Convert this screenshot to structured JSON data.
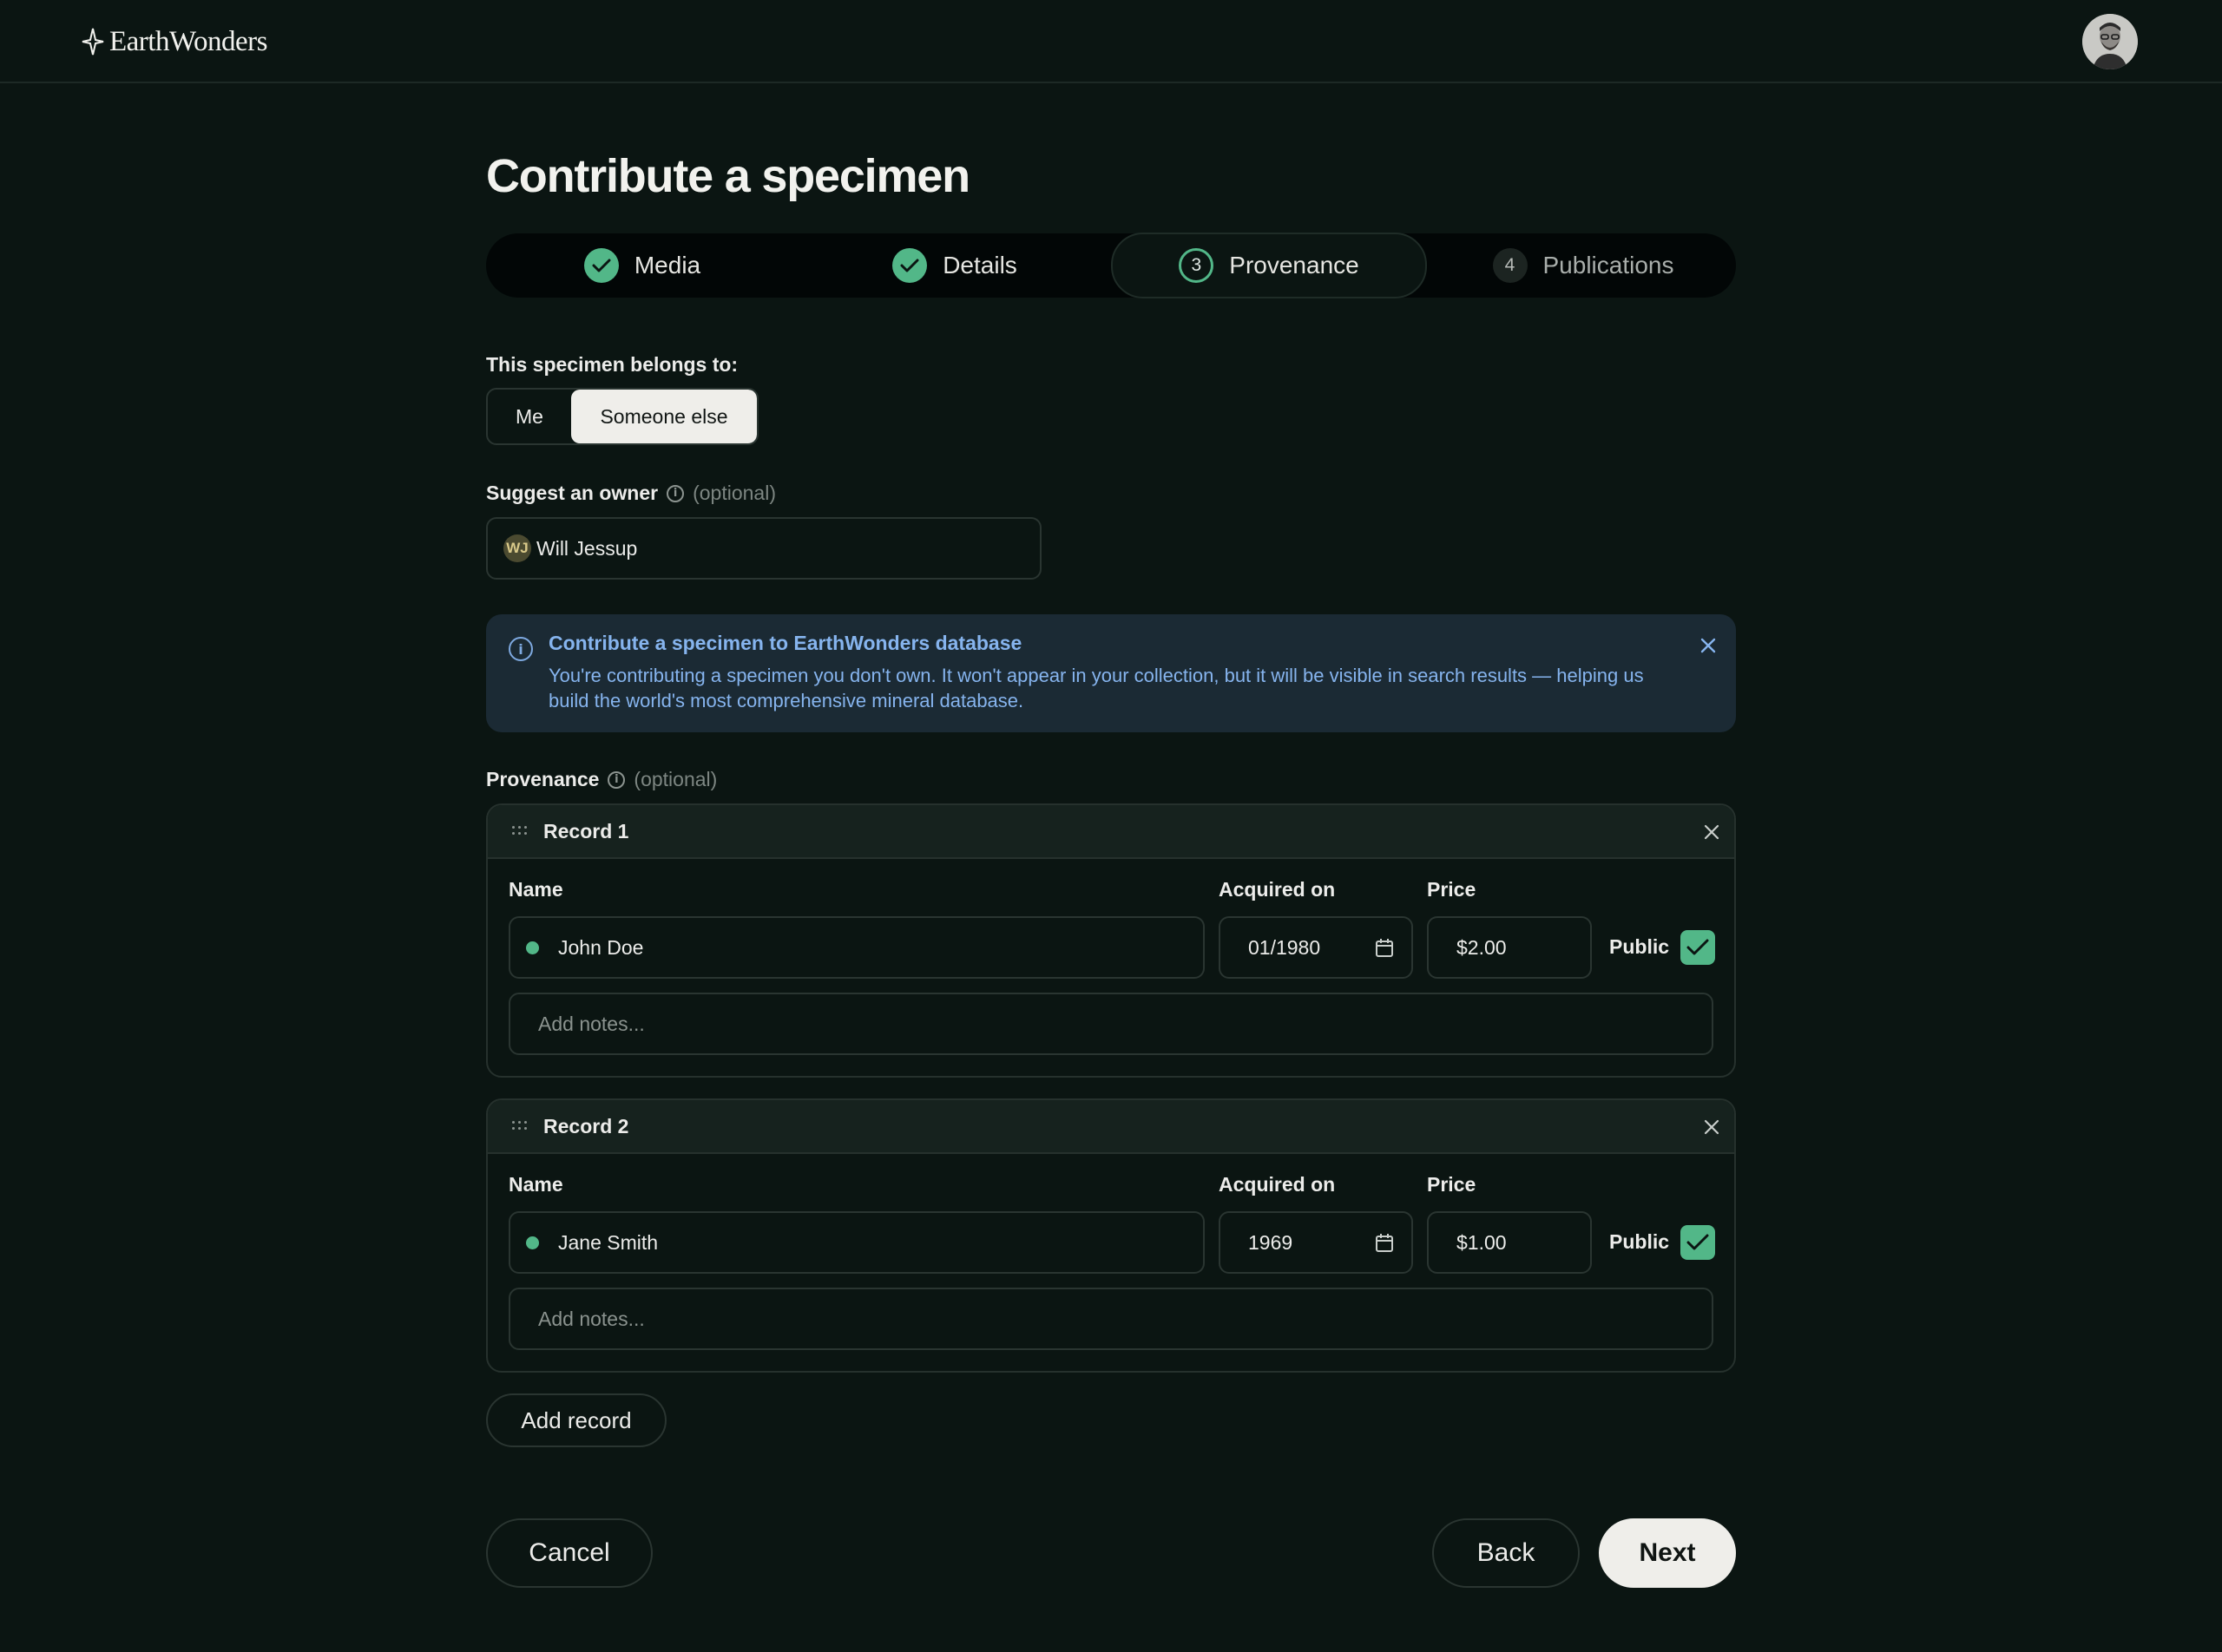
{
  "header": {
    "logo_text": "EarthWonders",
    "avatar_alt": "user-avatar"
  },
  "page": {
    "title": "Contribute a specimen"
  },
  "stepper": {
    "steps": [
      {
        "label": "Media",
        "state": "done"
      },
      {
        "label": "Details",
        "state": "done"
      },
      {
        "label": "Provenance",
        "state": "active",
        "number": "3"
      },
      {
        "label": "Publications",
        "state": "upcoming",
        "number": "4"
      }
    ]
  },
  "belongs": {
    "label": "This specimen belongs to:",
    "options": [
      "Me",
      "Someone else"
    ],
    "selected": "Someone else"
  },
  "owner": {
    "label": "Suggest an owner",
    "optional": "(optional)",
    "initials": "WJ",
    "value": "Will Jessup"
  },
  "banner": {
    "title": "Contribute a specimen to EarthWonders database",
    "text": "You're contributing a specimen you don't own. It won't appear in your collection, but it will be visible in search results — helping us build the world's most comprehensive mineral database."
  },
  "provenance": {
    "label": "Provenance",
    "optional": "(optional)",
    "columns": {
      "name": "Name",
      "acquired": "Acquired on",
      "price": "Price",
      "public": "Public"
    },
    "records": [
      {
        "title": "Record 1",
        "name": "John Doe",
        "acquired": "01/1980",
        "price": "$2.00",
        "public": true,
        "notes_placeholder": "Add notes..."
      },
      {
        "title": "Record 2",
        "name": "Jane Smith",
        "acquired": "1969",
        "price": "$1.00",
        "public": true,
        "notes_placeholder": "Add notes..."
      }
    ],
    "add_label": "Add record"
  },
  "footer": {
    "cancel": "Cancel",
    "back": "Back",
    "next": "Next"
  },
  "colors": {
    "background": "#0b1512",
    "accent_green": "#52b788",
    "banner_bg": "#1b2a34",
    "banner_text": "#86b4ee"
  }
}
